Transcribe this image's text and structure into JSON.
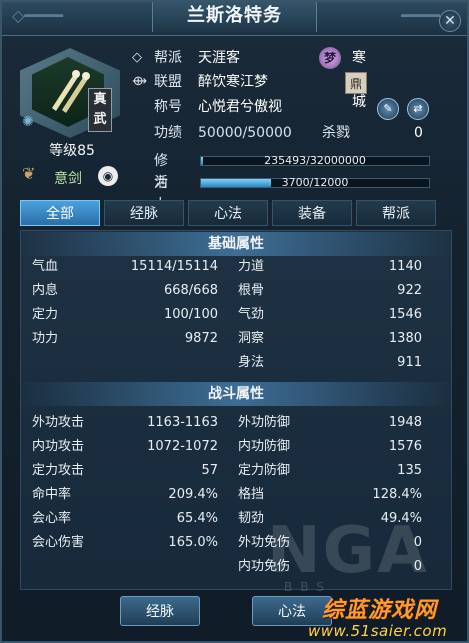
{
  "window": {
    "title": "兰斯洛特务",
    "close_glyph": "✕"
  },
  "character": {
    "badge": "真武",
    "level": "等级85",
    "school": "意剑",
    "eye_glyph": "◉"
  },
  "info": {
    "faction_label": "帮派",
    "faction_value": "天涯客",
    "city_badge": "梦",
    "city_value": "寒江城",
    "alliance_label": "联盟",
    "alliance_value": "醉饮寒江梦",
    "alliance_badge": "鼎",
    "title_label": "称号",
    "title_value": "心悦君兮傲视",
    "merit_label": "功绩",
    "merit_value": "50000/50000",
    "kill_label": "杀戮",
    "kill_value": "0",
    "cultivation_label": "修为",
    "cultivation_text": "235493/32000000",
    "cultivation_fraction": 0.0074,
    "vitality_label": "活力",
    "vitality_text": "3700/12000",
    "vitality_fraction": 0.308
  },
  "tabs": [
    "全部",
    "经脉",
    "心法",
    "装备",
    "帮派"
  ],
  "base_section": {
    "title": "基础属性",
    "left": [
      {
        "label": "气血",
        "value": "15114/15114"
      },
      {
        "label": "内息",
        "value": "668/668"
      },
      {
        "label": "定力",
        "value": "100/100"
      },
      {
        "label": "功力",
        "value": "9872"
      }
    ],
    "right": [
      {
        "label": "力道",
        "value": "1140"
      },
      {
        "label": "根骨",
        "value": "922"
      },
      {
        "label": "气劲",
        "value": "1546"
      },
      {
        "label": "洞察",
        "value": "1380"
      },
      {
        "label": "身法",
        "value": "911"
      }
    ]
  },
  "combat_section": {
    "title": "战斗属性",
    "left": [
      {
        "label": "外功攻击",
        "value": "1163-1163"
      },
      {
        "label": "内功攻击",
        "value": "1072-1072"
      },
      {
        "label": "定力攻击",
        "value": "57"
      },
      {
        "label": "命中率",
        "value": "209.4%"
      },
      {
        "label": "会心率",
        "value": "65.4%"
      },
      {
        "label": "会心伤害",
        "value": "165.0%"
      }
    ],
    "right": [
      {
        "label": "外功防御",
        "value": "1948"
      },
      {
        "label": "内功防御",
        "value": "1576"
      },
      {
        "label": "定力防御",
        "value": "135"
      },
      {
        "label": "格挡",
        "value": "128.4%"
      },
      {
        "label": "韧劲",
        "value": "49.4%"
      },
      {
        "label": "外功免伤",
        "value": "0"
      },
      {
        "label": "内功免伤",
        "value": "0"
      }
    ]
  },
  "watermark": {
    "text": "NGA",
    "sub": "BBS"
  },
  "bottom": {
    "meridian_button": "经脉",
    "mind_button": "心法"
  },
  "site": {
    "logo": "综蓝游戏网",
    "url": "www.51saier.com"
  }
}
